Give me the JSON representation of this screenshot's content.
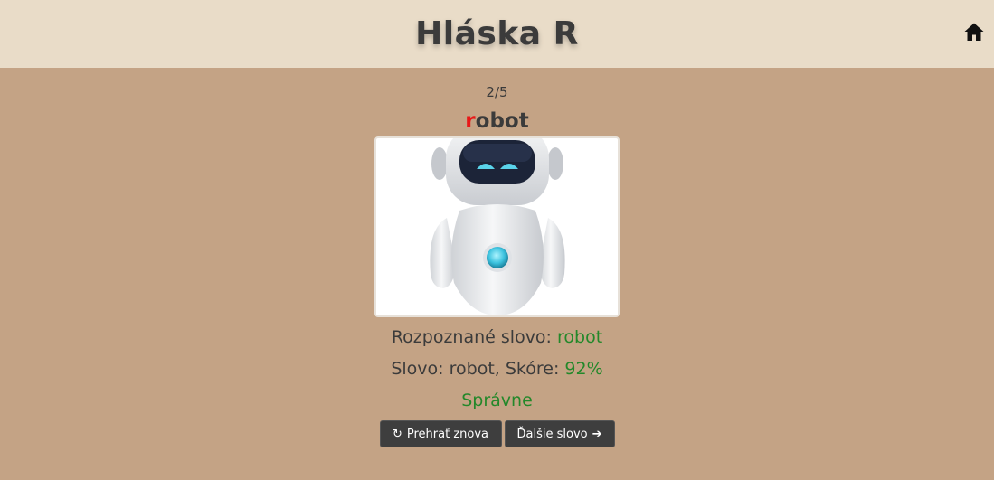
{
  "header": {
    "title": "Hláska R",
    "home_icon": "home-icon"
  },
  "progress": {
    "counter": "2/5"
  },
  "word": {
    "first_letter": "r",
    "rest": "obot",
    "highlight_color": "#e81717"
  },
  "picture": {
    "subject": "robot"
  },
  "result": {
    "recognized_label": "Rozpoznané slovo:",
    "recognized_value": "robot",
    "score_label": "Slovo: robot, Skóre:",
    "score_value": "92%",
    "verdict": "Správne",
    "success_color": "#23882a"
  },
  "buttons": {
    "replay_label": "Prehrať znova",
    "replay_icon": "redo-icon",
    "next_label": "Ďalšie slovo",
    "next_icon": "arrow-right-icon"
  }
}
